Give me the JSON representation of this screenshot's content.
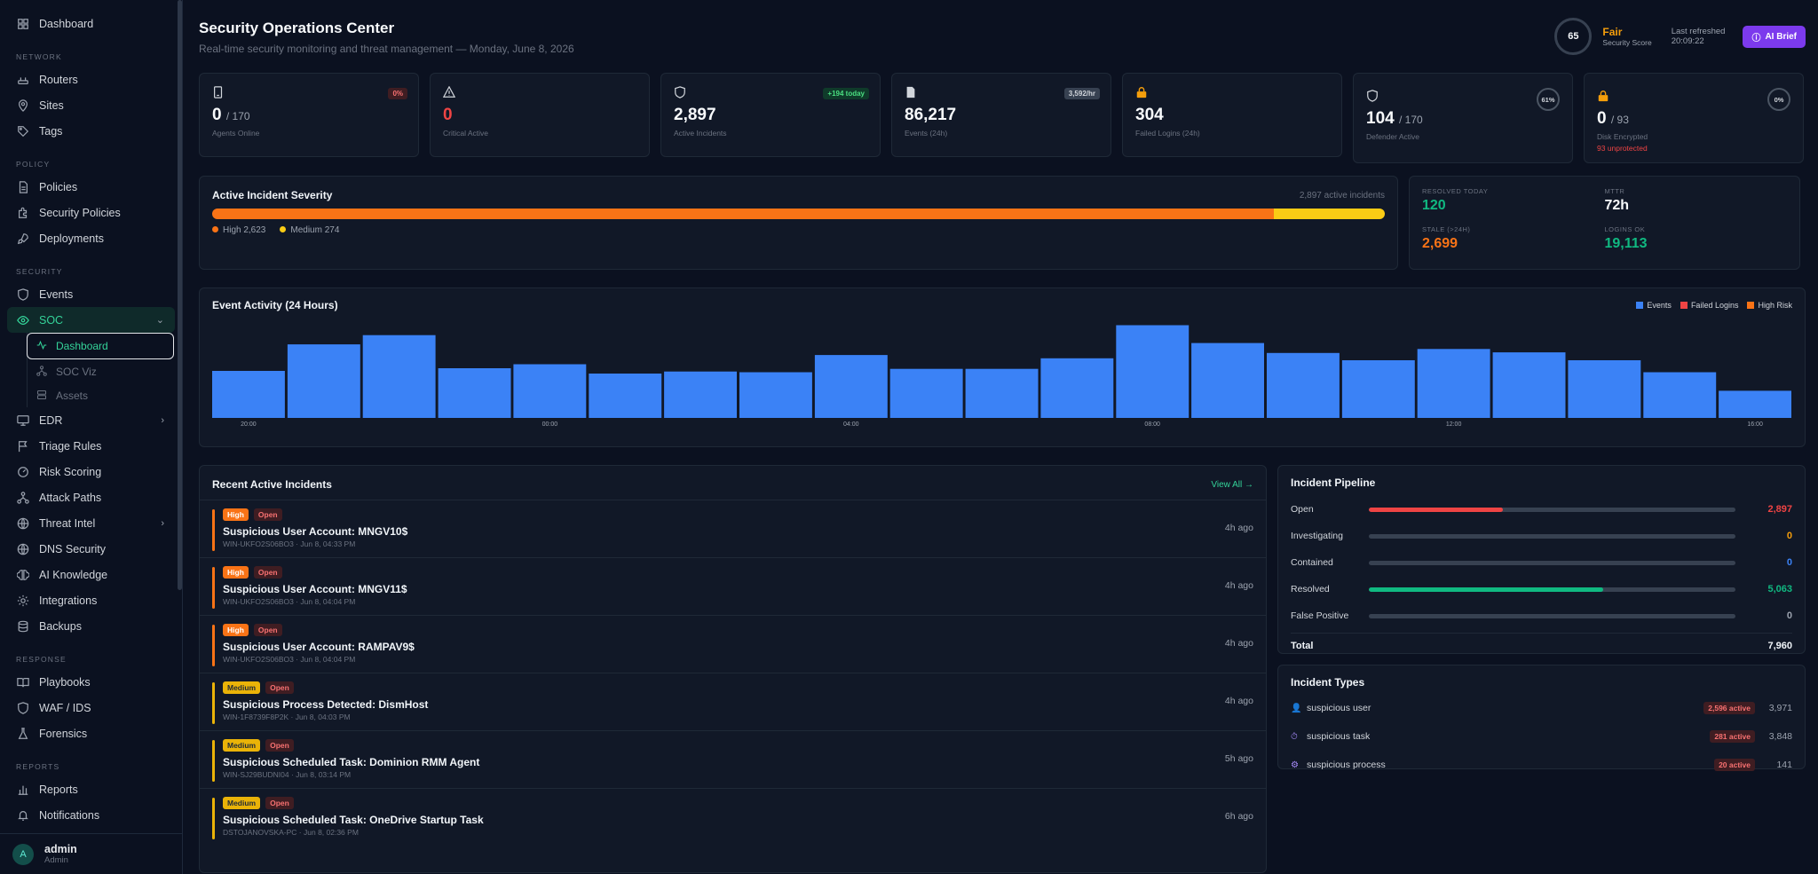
{
  "sidebar": {
    "top": {
      "label": "Dashboard",
      "icon": "dashboard-icon"
    },
    "sections": [
      {
        "title": "NETWORK",
        "items": [
          {
            "label": "Routers",
            "icon": "router-icon"
          },
          {
            "label": "Sites",
            "icon": "map-pin-icon"
          },
          {
            "label": "Tags",
            "icon": "tag-icon"
          }
        ]
      },
      {
        "title": "POLICY",
        "items": [
          {
            "label": "Policies",
            "icon": "file-icon"
          },
          {
            "label": "Security Policies",
            "icon": "puzzle-icon"
          },
          {
            "label": "Deployments",
            "icon": "rocket-icon"
          }
        ]
      },
      {
        "title": "SECURITY",
        "items": [
          {
            "label": "Events",
            "icon": "shield-icon"
          },
          {
            "label": "SOC",
            "icon": "eye-icon"
          },
          {
            "label": "EDR",
            "icon": "monitor-icon"
          },
          {
            "label": "Triage Rules",
            "icon": "flag-icon"
          },
          {
            "label": "Risk Scoring",
            "icon": "gauge-icon"
          },
          {
            "label": "Attack Paths",
            "icon": "network-icon"
          },
          {
            "label": "Threat Intel",
            "icon": "globe-icon"
          },
          {
            "label": "DNS Security",
            "icon": "globe-icon"
          },
          {
            "label": "AI Knowledge",
            "icon": "brain-icon"
          },
          {
            "label": "Integrations",
            "icon": "gear-icon"
          },
          {
            "label": "Backups",
            "icon": "database-icon"
          }
        ]
      },
      {
        "title": "RESPONSE",
        "items": [
          {
            "label": "Playbooks",
            "icon": "book-icon"
          },
          {
            "label": "WAF / IDS",
            "icon": "shield-icon"
          },
          {
            "label": "Forensics",
            "icon": "flask-icon"
          }
        ]
      },
      {
        "title": "REPORTS",
        "items": [
          {
            "label": "Reports",
            "icon": "bar-chart-icon"
          },
          {
            "label": "Notifications",
            "icon": "bell-icon"
          }
        ]
      }
    ],
    "soc_sub": [
      {
        "label": "Dashboard",
        "icon": "activity-icon"
      },
      {
        "label": "SOC Viz",
        "icon": "network-icon"
      },
      {
        "label": "Assets",
        "icon": "server-icon"
      }
    ],
    "user": {
      "initial": "A",
      "name": "admin",
      "role": "Admin"
    }
  },
  "header": {
    "title": "Security Operations Center",
    "subtitle": "Real-time security monitoring and threat management — Monday, June 8, 2026",
    "score": "65",
    "score_label": "Fair",
    "score_caption": "Security Score",
    "refresh_label": "Last refreshed",
    "refresh_time": "20:09:22",
    "ai_button": "AI Brief"
  },
  "kpis": [
    {
      "icon": "agent-icon",
      "value": "0",
      "of": "/ 170",
      "label": "Agents Online",
      "pill": "0%",
      "pill_style": "red"
    },
    {
      "icon": "warning-icon",
      "value": "0",
      "value_color": "#ef4444",
      "label": "Critical Active"
    },
    {
      "icon": "shield-icon",
      "value": "2,897",
      "label": "Active Incidents",
      "pill": "+194 today",
      "pill_style": "green"
    },
    {
      "icon": "document-icon",
      "value": "86,217",
      "label": "Events (24h)",
      "pill": "3,592/hr",
      "pill_style": "gray"
    },
    {
      "icon": "lock-icon",
      "value": "304",
      "label": "Failed Logins (24h)"
    },
    {
      "icon": "shield-icon",
      "value": "104",
      "of": "/ 170",
      "label": "Defender Active",
      "ring": "61%"
    },
    {
      "icon": "lock-icon",
      "value": "0",
      "of": "/ 93",
      "label": "Disk Encrypted",
      "ring": "0%",
      "warn": "93 unprotected"
    }
  ],
  "severity": {
    "title": "Active Incident Severity",
    "count": "2,897 active incidents",
    "high_label": "High 2,623",
    "medium_label": "Medium 274",
    "high": 2623,
    "medium": 274,
    "high_color": "#f97316",
    "medium_color": "#facc15"
  },
  "stats": [
    {
      "title": "RESOLVED TODAY",
      "value": "120",
      "color": "#10b981"
    },
    {
      "title": "MTTR",
      "value": "72h",
      "color": "#f8fafc"
    },
    {
      "title": "STALE (>24H)",
      "value": "2,699",
      "color": "#f97316"
    },
    {
      "title": "LOGINS OK",
      "value": "19,113",
      "color": "#10b981"
    }
  ],
  "activity": {
    "title": "Event Activity (24 Hours)",
    "legend": [
      "Events",
      "Failed Logins",
      "High Risk"
    ],
    "legend_colors": [
      "#3b82f6",
      "#ef4444",
      "#f97316"
    ]
  },
  "chart_data": {
    "type": "bar",
    "title": "Event Activity (24 Hours)",
    "categories": [
      "20:00",
      "21:00",
      "22:00",
      "23:00",
      "00:00",
      "01:00",
      "02:00",
      "03:00",
      "04:00",
      "05:00",
      "06:00",
      "07:00",
      "08:00",
      "09:00",
      "10:00",
      "11:00",
      "12:00",
      "13:00",
      "14:00",
      "15:00",
      "16:00"
    ],
    "tick_labels": [
      "20:00",
      "",
      "",
      "",
      "00:00",
      "",
      "",
      "",
      "04:00",
      "",
      "",
      "",
      "08:00",
      "",
      "",
      "",
      "12:00",
      "",
      "",
      "",
      "16:00"
    ],
    "series": [
      {
        "name": "Events",
        "color": "#3b82f6",
        "values": [
          3550,
          5550,
          6250,
          3750,
          4050,
          3350,
          3500,
          3450,
          4750,
          3700,
          3700,
          4500,
          7000,
          5650,
          4900,
          4350,
          5200,
          4950,
          4350,
          3450,
          2050
        ]
      },
      {
        "name": "Failed Logins",
        "color": "#ef4444",
        "values": []
      },
      {
        "name": "High Risk",
        "color": "#f97316",
        "values": []
      }
    ],
    "ylim": [
      0,
      7500
    ]
  },
  "incidents": {
    "title": "Recent Active Incidents",
    "view_all": "View All →",
    "items": [
      {
        "severity": "High",
        "status": "Open",
        "name": "Suspicious User Account: MNGV10$",
        "meta": "WIN-UKFO2S06BO3 · Jun 8, 04:33 PM",
        "ago": "4h ago"
      },
      {
        "severity": "High",
        "status": "Open",
        "name": "Suspicious User Account: MNGV11$",
        "meta": "WIN-UKFO2S06BO3 · Jun 8, 04:04 PM",
        "ago": "4h ago"
      },
      {
        "severity": "High",
        "status": "Open",
        "name": "Suspicious User Account: RAMPAV9$",
        "meta": "WIN-UKFO2S06BO3 · Jun 8, 04:04 PM",
        "ago": "4h ago"
      },
      {
        "severity": "Medium",
        "status": "Open",
        "name": "Suspicious Process Detected: DismHost",
        "meta": "WIN-1F8739F8P2K · Jun 8, 04:03 PM",
        "ago": "4h ago"
      },
      {
        "severity": "Medium",
        "status": "Open",
        "name": "Suspicious Scheduled Task: Dominion RMM Agent",
        "meta": "WIN-SJ29BUDNI04 · Jun 8, 03:14 PM",
        "ago": "5h ago"
      },
      {
        "severity": "Medium",
        "status": "Open",
        "name": "Suspicious Scheduled Task: OneDrive Startup Task",
        "meta": "DSTOJANOVSKA-PC · Jun 8, 02:36 PM",
        "ago": "6h ago"
      }
    ]
  },
  "pipeline": {
    "title": "Incident Pipeline",
    "rows": [
      {
        "label": "Open",
        "value": "2,897",
        "fraction": 0.366,
        "color": "#ef4444"
      },
      {
        "label": "Investigating",
        "value": "0",
        "fraction": 0,
        "color": "#f59e0b"
      },
      {
        "label": "Contained",
        "value": "0",
        "fraction": 0,
        "color": "#3b82f6"
      },
      {
        "label": "Resolved",
        "value": "5,063",
        "fraction": 0.64,
        "color": "#10b981"
      },
      {
        "label": "False Positive",
        "value": "0",
        "fraction": 0,
        "color": "#9ca3af"
      }
    ],
    "total_label": "Total",
    "total": "7,960"
  },
  "types": {
    "title": "Incident Types",
    "rows": [
      {
        "icon": "user-icon",
        "glyph": "👤",
        "name": "suspicious user",
        "active": "2,596 active",
        "total": "3,971"
      },
      {
        "icon": "clock-icon",
        "glyph": "⏱",
        "name": "suspicious task",
        "active": "281 active",
        "total": "3,848"
      },
      {
        "icon": "gear-icon",
        "glyph": "⚙",
        "name": "suspicious process",
        "active": "20 active",
        "total": "141"
      }
    ]
  }
}
